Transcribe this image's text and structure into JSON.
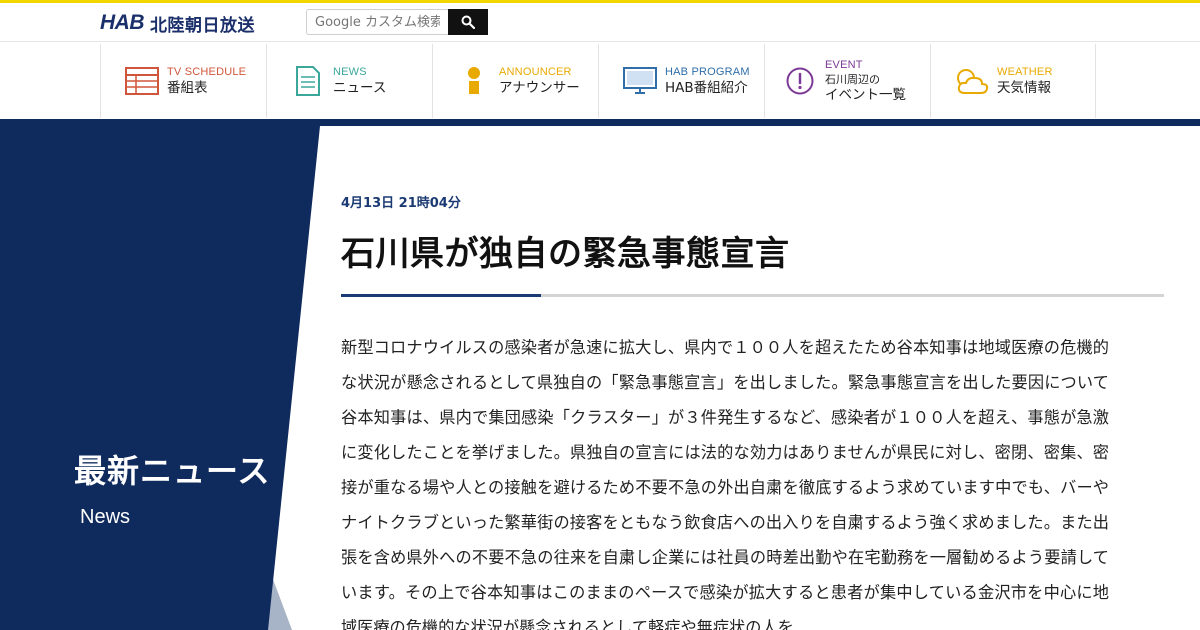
{
  "header": {
    "logo_mark": "HAB",
    "logo_name": "北陸朝日放送",
    "search_placeholder": "Google カスタム検索"
  },
  "nav": {
    "items": [
      {
        "en": "TV SCHEDULE",
        "jp": "番組表",
        "icon": "tv-schedule-icon",
        "color": "#d0563b"
      },
      {
        "en": "NEWS",
        "jp": "ニュース",
        "icon": "news-icon",
        "color": "#3ba79a"
      },
      {
        "en": "ANNOUNCER",
        "jp": "アナウンサー",
        "icon": "announcer-icon",
        "color": "#e8a900"
      },
      {
        "en": "HAB PROGRAM",
        "jp": "HAB番組紹介",
        "icon": "monitor-icon",
        "color": "#2f6ea8"
      },
      {
        "en": "EVENT",
        "jp": "石川周辺の",
        "jp2": "イベント一覧",
        "icon": "event-icon",
        "color": "#7c3a96"
      },
      {
        "en": "WEATHER",
        "jp": "天気情報",
        "icon": "weather-icon",
        "color": "#e8a900"
      }
    ]
  },
  "section": {
    "title": "最新ニュース",
    "subtitle": "News"
  },
  "article": {
    "date": "4月13日 21時04分",
    "headline": "石川県が独自の緊急事態宣言",
    "body": "新型コロナウイルスの感染者が急速に拡大し、県内で１００人を超えたため谷本知事は地域医療の危機的な状況が懸念されるとして県独自の「緊急事態宣言」を出しました。緊急事態宣言を出した要因について谷本知事は、県内で集団感染「クラスター」が３件発生するなど、感染者が１００人を超え、事態が急激に変化したことを挙げました。県独自の宣言には法的な効力はありませんが県民に対し、密閉、密集、密接が重なる場や人との接触を避けるため不要不急の外出自粛を徹底するよう求めています中でも、バーやナイトクラブといった繁華街の接客をともなう飲食店への出入りを自粛するよう強く求めました。また出張を含め県外への不要不急の往来を自粛し企業には社員の時差出勤や在宅勤務を一層勧めるよう要請しています。その上で谷本知事はこのままのペースで感染が拡大すると患者が集中している金沢市を中心に地域医療の危機的な状況が懸念されるとして軽症や無症状の人を"
  },
  "colors": {
    "accent_yellow": "#f2d600",
    "navy": "#0f2a5c",
    "date_blue": "#1b3a73"
  }
}
